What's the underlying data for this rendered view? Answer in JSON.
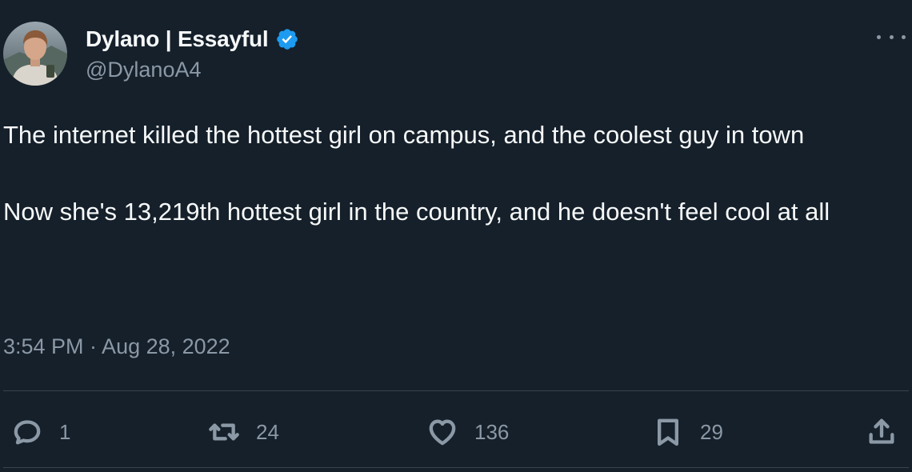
{
  "author": {
    "display_name": "Dylano | Essayful",
    "handle": "@DylanoA4",
    "verified": true,
    "verified_color": "#1d9bf0"
  },
  "tweet": {
    "paragraphs": [
      "The internet killed the hottest girl on campus, and the coolest guy in town",
      "Now she's 13,219th hottest girl in the country, and he doesn't feel cool at all"
    ],
    "timestamp": "3:54 PM · Aug 28, 2022"
  },
  "actions": {
    "reply_count": "1",
    "retweet_count": "24",
    "like_count": "136",
    "bookmark_count": "29"
  },
  "icons": {
    "more": "more-icon",
    "reply": "reply-icon",
    "retweet": "retweet-icon",
    "like": "heart-icon",
    "bookmark": "bookmark-icon",
    "share": "share-icon",
    "verified": "verified-badge-icon"
  },
  "colors": {
    "background": "#15202b",
    "text": "#f7f9f9",
    "secondary_text": "#8b98a5",
    "divider": "#38444d"
  }
}
